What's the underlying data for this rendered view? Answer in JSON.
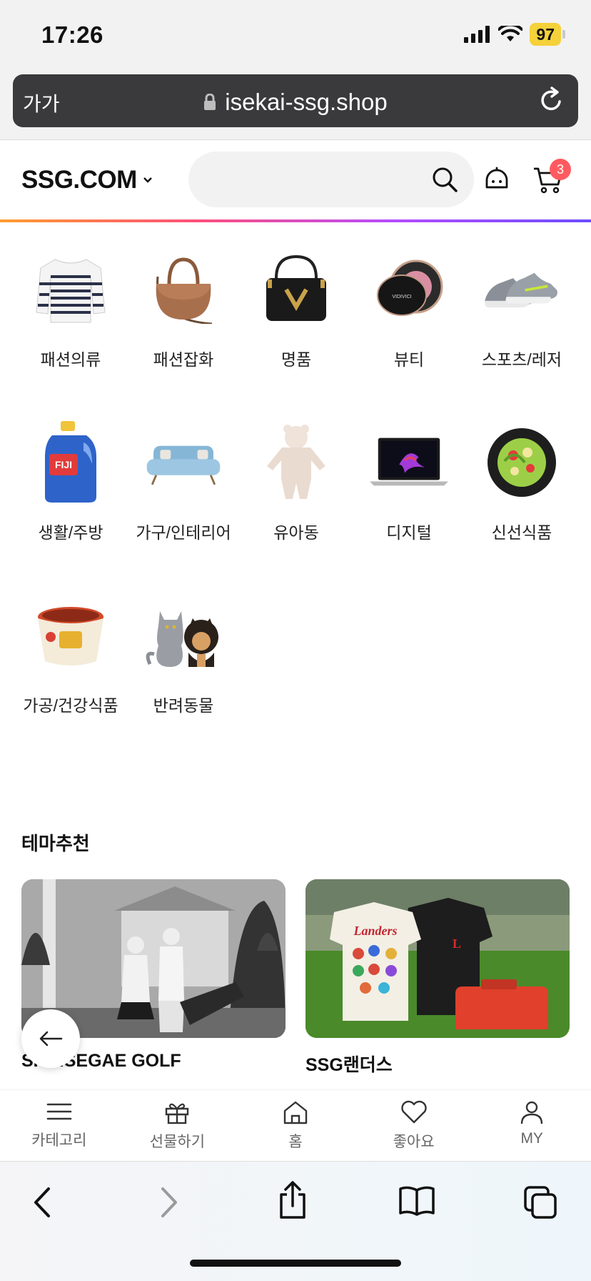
{
  "status": {
    "time": "17:26",
    "battery": "97"
  },
  "browser": {
    "aa_label": "가가",
    "url": "isekai-ssg.shop"
  },
  "header": {
    "logo": "SSG.COM",
    "cart_count": "3",
    "search_placeholder": ""
  },
  "categories": [
    {
      "label": "패션의류",
      "icon": "striped-shirt"
    },
    {
      "label": "패션잡화",
      "icon": "handbag"
    },
    {
      "label": "명품",
      "icon": "luxury-bag"
    },
    {
      "label": "뷰티",
      "icon": "cushion-compact"
    },
    {
      "label": "스포츠/레저",
      "icon": "sneakers"
    },
    {
      "label": "생활/주방",
      "icon": "detergent-bottle"
    },
    {
      "label": "가구/인테리어",
      "icon": "sofa"
    },
    {
      "label": "유아동",
      "icon": "baby-romper"
    },
    {
      "label": "디지털",
      "icon": "laptop"
    },
    {
      "label": "신선식품",
      "icon": "salad-plate"
    },
    {
      "label": "가공/건강식품",
      "icon": "instant-rice-bowl"
    },
    {
      "label": "반려동물",
      "icon": "cat-and-dog"
    }
  ],
  "theme": {
    "title": "테마추천",
    "cards": [
      {
        "name": "SHINSEGAE GOLF"
      },
      {
        "name": "SSG랜더스"
      }
    ]
  },
  "bottom_nav": [
    {
      "label": "카테고리",
      "icon": "menu-icon"
    },
    {
      "label": "선물하기",
      "icon": "gift-icon"
    },
    {
      "label": "홈",
      "icon": "home-icon"
    },
    {
      "label": "좋아요",
      "icon": "heart-icon"
    },
    {
      "label": "MY",
      "icon": "user-icon"
    }
  ],
  "colors": {
    "accent_gradient": [
      "#ff9d2e",
      "#ff4f7b",
      "#b54cff",
      "#6c4cff"
    ],
    "badge": "#ff5a5f",
    "battery": "#f5d13a"
  }
}
